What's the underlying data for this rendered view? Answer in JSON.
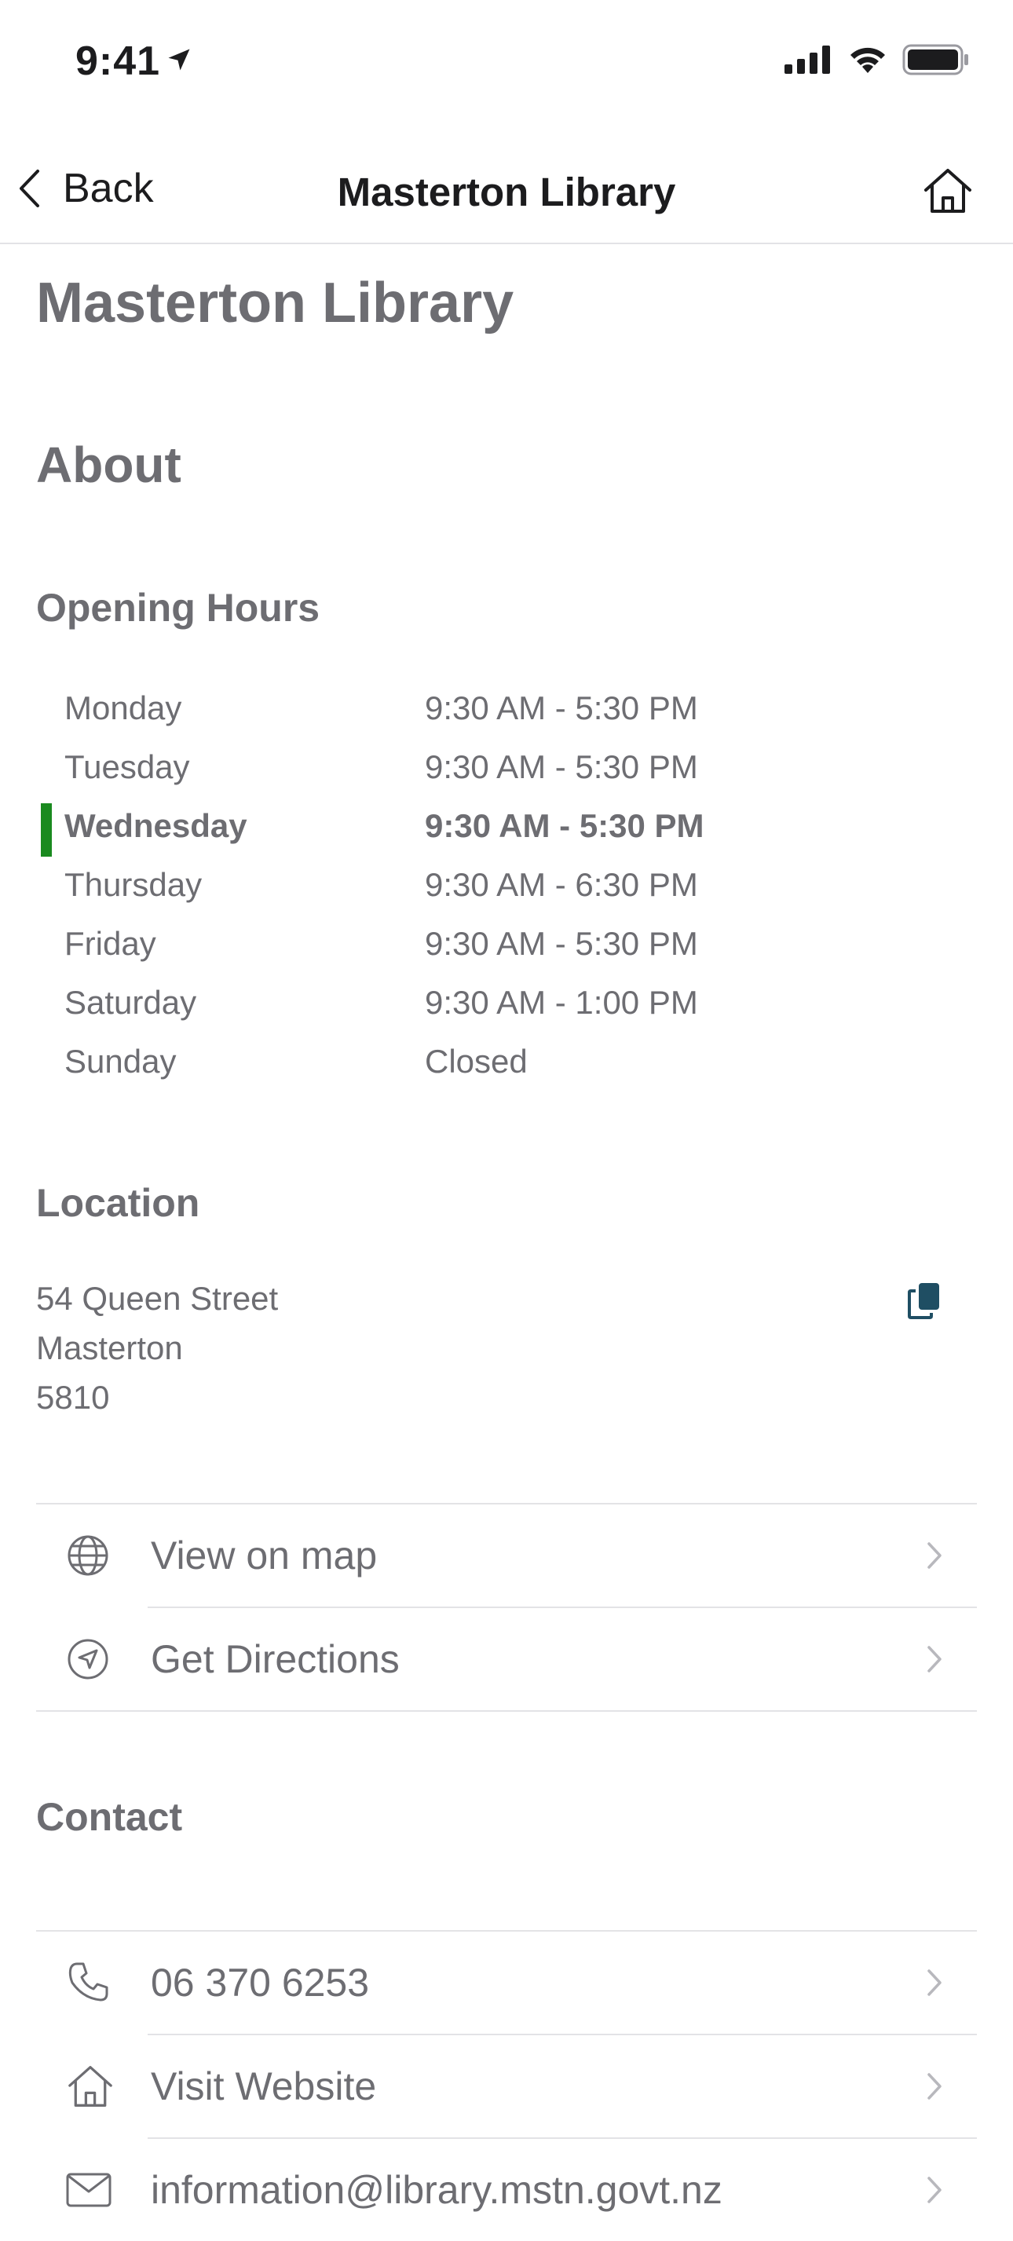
{
  "status_bar": {
    "time": "9:41"
  },
  "nav": {
    "back_label": "Back",
    "title": "Masterton Library"
  },
  "page": {
    "title": "Masterton Library",
    "about_heading": "About"
  },
  "opening_hours": {
    "heading": "Opening Hours",
    "today_indicator_color": "#1a8a1f",
    "rows": [
      {
        "day": "Monday",
        "hours": "9:30 AM - 5:30 PM"
      },
      {
        "day": "Tuesday",
        "hours": "9:30 AM - 5:30 PM"
      },
      {
        "day": "Wednesday",
        "hours": "9:30 AM - 5:30 PM",
        "today": true
      },
      {
        "day": "Thursday",
        "hours": "9:30 AM - 6:30 PM"
      },
      {
        "day": "Friday",
        "hours": "9:30 AM - 5:30 PM"
      },
      {
        "day": "Saturday",
        "hours": "9:30 AM - 1:00 PM"
      },
      {
        "day": "Sunday",
        "hours": "Closed"
      }
    ]
  },
  "location": {
    "heading": "Location",
    "address_line1": "54 Queen Street",
    "address_line2": "Masterton",
    "address_line3": "5810",
    "copy_icon": "copy-icon",
    "actions": [
      {
        "label": "View on map",
        "icon": "globe-icon"
      },
      {
        "label": "Get Directions",
        "icon": "navigation-icon"
      }
    ]
  },
  "contact": {
    "heading": "Contact",
    "actions": [
      {
        "label": "06 370 6253",
        "icon": "phone-icon"
      },
      {
        "label": "Visit Website",
        "icon": "home-icon"
      },
      {
        "label": "information@library.mstn.govt.nz",
        "icon": "mail-icon"
      }
    ]
  },
  "colors": {
    "accent_dark": "#1f4e63",
    "text_gray": "#6d6d72",
    "divider": "#e3e3e6"
  }
}
